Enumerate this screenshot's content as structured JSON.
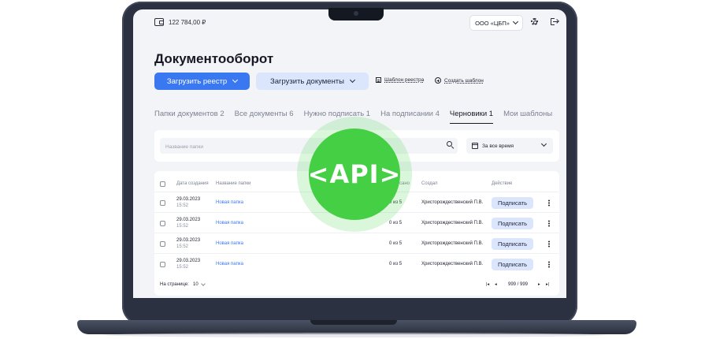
{
  "header": {
    "balance": "122 784,00 ₽",
    "organization": "ООО «ЦБП»"
  },
  "page": {
    "title": "Документооборот"
  },
  "toolbar": {
    "upload_registry": "Загрузить реестр",
    "upload_documents": "Загрузить документы",
    "registry_template": "Шаблон реестра",
    "create_template": "Создать шаблон"
  },
  "tabs": [
    {
      "label": "Папки документов 2",
      "active": false
    },
    {
      "label": "Все документы 6",
      "active": false
    },
    {
      "label": "Нужно подписать 1",
      "active": false
    },
    {
      "label": "На подписании 4",
      "active": false
    },
    {
      "label": "Черновики 1",
      "active": true
    },
    {
      "label": "Мои шаблоны",
      "active": false
    }
  ],
  "filters": {
    "search_placeholder": "Название папки",
    "period": "За все время"
  },
  "table": {
    "columns": {
      "created": "Дата создания",
      "name": "Название папки",
      "signed": "сано",
      "author": "Создал",
      "action": "Действие"
    },
    "rows": [
      {
        "date": "29.03.2023",
        "time": "15:52",
        "name": "Новая папка",
        "signed": "0 из 5",
        "author": "Христорождественский П.В.",
        "action": "Подписать"
      },
      {
        "date": "29.03.2023",
        "time": "15:52",
        "name": "Новая папка",
        "signed": "0 из 5",
        "author": "Христорождественский П.В.",
        "action": "Подписать"
      },
      {
        "date": "29.03.2023",
        "time": "15:52",
        "name": "Новая папка",
        "signed": "0 из 5",
        "author": "Христорождественский П.В.",
        "action": "Подписать"
      },
      {
        "date": "29.03.2023",
        "time": "15:52",
        "name": "Новая папка",
        "signed": "0 из 5",
        "author": "Христорождественский П.В.",
        "action": "Подписать"
      }
    ]
  },
  "pagination": {
    "per_page_label": "На странице:",
    "per_page_value": "10",
    "first": "|◂",
    "prev": "◂",
    "pages": "999 / 999",
    "next": "▸",
    "last": "▸|"
  },
  "badge": {
    "text": "<API>",
    "color": "#45cf45"
  },
  "colors": {
    "primary": "#3a78f2",
    "secondary_bg": "#dbe6fd",
    "screen_bg": "#f3f4f8",
    "frame": "#2b3140"
  }
}
